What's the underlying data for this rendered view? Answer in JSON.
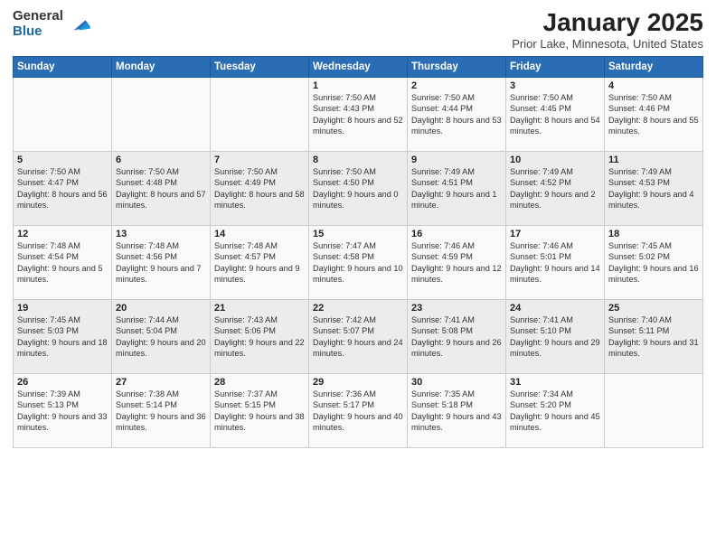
{
  "logo": {
    "general": "General",
    "blue": "Blue"
  },
  "title": "January 2025",
  "location": "Prior Lake, Minnesota, United States",
  "days_of_week": [
    "Sunday",
    "Monday",
    "Tuesday",
    "Wednesday",
    "Thursday",
    "Friday",
    "Saturday"
  ],
  "weeks": [
    [
      {
        "day": "",
        "content": ""
      },
      {
        "day": "",
        "content": ""
      },
      {
        "day": "",
        "content": ""
      },
      {
        "day": "1",
        "content": "Sunrise: 7:50 AM\nSunset: 4:43 PM\nDaylight: 8 hours\nand 52 minutes."
      },
      {
        "day": "2",
        "content": "Sunrise: 7:50 AM\nSunset: 4:44 PM\nDaylight: 8 hours\nand 53 minutes."
      },
      {
        "day": "3",
        "content": "Sunrise: 7:50 AM\nSunset: 4:45 PM\nDaylight: 8 hours\nand 54 minutes."
      },
      {
        "day": "4",
        "content": "Sunrise: 7:50 AM\nSunset: 4:46 PM\nDaylight: 8 hours\nand 55 minutes."
      }
    ],
    [
      {
        "day": "5",
        "content": "Sunrise: 7:50 AM\nSunset: 4:47 PM\nDaylight: 8 hours\nand 56 minutes."
      },
      {
        "day": "6",
        "content": "Sunrise: 7:50 AM\nSunset: 4:48 PM\nDaylight: 8 hours\nand 57 minutes."
      },
      {
        "day": "7",
        "content": "Sunrise: 7:50 AM\nSunset: 4:49 PM\nDaylight: 8 hours\nand 58 minutes."
      },
      {
        "day": "8",
        "content": "Sunrise: 7:50 AM\nSunset: 4:50 PM\nDaylight: 9 hours\nand 0 minutes."
      },
      {
        "day": "9",
        "content": "Sunrise: 7:49 AM\nSunset: 4:51 PM\nDaylight: 9 hours\nand 1 minute."
      },
      {
        "day": "10",
        "content": "Sunrise: 7:49 AM\nSunset: 4:52 PM\nDaylight: 9 hours\nand 2 minutes."
      },
      {
        "day": "11",
        "content": "Sunrise: 7:49 AM\nSunset: 4:53 PM\nDaylight: 9 hours\nand 4 minutes."
      }
    ],
    [
      {
        "day": "12",
        "content": "Sunrise: 7:48 AM\nSunset: 4:54 PM\nDaylight: 9 hours\nand 5 minutes."
      },
      {
        "day": "13",
        "content": "Sunrise: 7:48 AM\nSunset: 4:56 PM\nDaylight: 9 hours\nand 7 minutes."
      },
      {
        "day": "14",
        "content": "Sunrise: 7:48 AM\nSunset: 4:57 PM\nDaylight: 9 hours\nand 9 minutes."
      },
      {
        "day": "15",
        "content": "Sunrise: 7:47 AM\nSunset: 4:58 PM\nDaylight: 9 hours\nand 10 minutes."
      },
      {
        "day": "16",
        "content": "Sunrise: 7:46 AM\nSunset: 4:59 PM\nDaylight: 9 hours\nand 12 minutes."
      },
      {
        "day": "17",
        "content": "Sunrise: 7:46 AM\nSunset: 5:01 PM\nDaylight: 9 hours\nand 14 minutes."
      },
      {
        "day": "18",
        "content": "Sunrise: 7:45 AM\nSunset: 5:02 PM\nDaylight: 9 hours\nand 16 minutes."
      }
    ],
    [
      {
        "day": "19",
        "content": "Sunrise: 7:45 AM\nSunset: 5:03 PM\nDaylight: 9 hours\nand 18 minutes."
      },
      {
        "day": "20",
        "content": "Sunrise: 7:44 AM\nSunset: 5:04 PM\nDaylight: 9 hours\nand 20 minutes."
      },
      {
        "day": "21",
        "content": "Sunrise: 7:43 AM\nSunset: 5:06 PM\nDaylight: 9 hours\nand 22 minutes."
      },
      {
        "day": "22",
        "content": "Sunrise: 7:42 AM\nSunset: 5:07 PM\nDaylight: 9 hours\nand 24 minutes."
      },
      {
        "day": "23",
        "content": "Sunrise: 7:41 AM\nSunset: 5:08 PM\nDaylight: 9 hours\nand 26 minutes."
      },
      {
        "day": "24",
        "content": "Sunrise: 7:41 AM\nSunset: 5:10 PM\nDaylight: 9 hours\nand 29 minutes."
      },
      {
        "day": "25",
        "content": "Sunrise: 7:40 AM\nSunset: 5:11 PM\nDaylight: 9 hours\nand 31 minutes."
      }
    ],
    [
      {
        "day": "26",
        "content": "Sunrise: 7:39 AM\nSunset: 5:13 PM\nDaylight: 9 hours\nand 33 minutes."
      },
      {
        "day": "27",
        "content": "Sunrise: 7:38 AM\nSunset: 5:14 PM\nDaylight: 9 hours\nand 36 minutes."
      },
      {
        "day": "28",
        "content": "Sunrise: 7:37 AM\nSunset: 5:15 PM\nDaylight: 9 hours\nand 38 minutes."
      },
      {
        "day": "29",
        "content": "Sunrise: 7:36 AM\nSunset: 5:17 PM\nDaylight: 9 hours\nand 40 minutes."
      },
      {
        "day": "30",
        "content": "Sunrise: 7:35 AM\nSunset: 5:18 PM\nDaylight: 9 hours\nand 43 minutes."
      },
      {
        "day": "31",
        "content": "Sunrise: 7:34 AM\nSunset: 5:20 PM\nDaylight: 9 hours\nand 45 minutes."
      },
      {
        "day": "",
        "content": ""
      }
    ]
  ]
}
